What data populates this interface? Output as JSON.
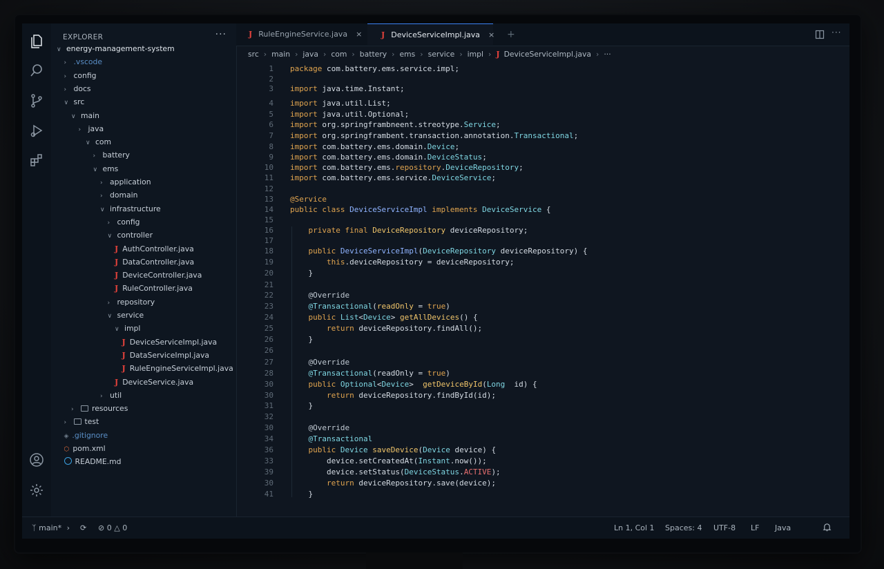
{
  "sidebar": {
    "title": "EXPLORER",
    "more": "···",
    "tree": [
      {
        "label": "energy-management-system",
        "depth": 0,
        "kind": "folder-open"
      },
      {
        "label": ".vscode",
        "depth": 1,
        "kind": "folder-closed",
        "dim": true
      },
      {
        "label": "config",
        "depth": 1,
        "kind": "folder-closed"
      },
      {
        "label": "docs",
        "depth": 1,
        "kind": "folder-closed"
      },
      {
        "label": "src",
        "depth": 1,
        "kind": "folder-open"
      },
      {
        "label": "main",
        "depth": 2,
        "kind": "folder-open"
      },
      {
        "label": "java",
        "depth": 3,
        "kind": "folder-closed"
      },
      {
        "label": "com",
        "depth": 4,
        "kind": "folder-open"
      },
      {
        "label": "battery",
        "depth": 5,
        "kind": "folder-closed"
      },
      {
        "label": "ems",
        "depth": 5,
        "kind": "folder-open"
      },
      {
        "label": "application",
        "depth": 6,
        "kind": "folder-closed"
      },
      {
        "label": "domain",
        "depth": 6,
        "kind": "folder-closed"
      },
      {
        "label": "infrastructure",
        "depth": 6,
        "kind": "folder-open"
      },
      {
        "label": "config",
        "depth": 7,
        "kind": "folder-closed"
      },
      {
        "label": "controller",
        "depth": 7,
        "kind": "folder-open"
      },
      {
        "label": "AuthController.java",
        "depth": 8,
        "kind": "java"
      },
      {
        "label": "DataController.java",
        "depth": 8,
        "kind": "java"
      },
      {
        "label": "DeviceController.java",
        "depth": 8,
        "kind": "java"
      },
      {
        "label": "RuleController.java",
        "depth": 8,
        "kind": "java"
      },
      {
        "label": "repository",
        "depth": 7,
        "kind": "folder-closed"
      },
      {
        "label": "service",
        "depth": 7,
        "kind": "folder-open"
      },
      {
        "label": "impl",
        "depth": 8,
        "kind": "folder-open"
      },
      {
        "label": "DeviceServiceImpl.java",
        "depth": 9,
        "kind": "java"
      },
      {
        "label": "DataServiceImpl.java",
        "depth": 9,
        "kind": "java"
      },
      {
        "label": "RuleEngineServiceImpl.java",
        "depth": 9,
        "kind": "java"
      },
      {
        "label": "DeviceService.java",
        "depth": 8,
        "kind": "java"
      },
      {
        "label": "util",
        "depth": 6,
        "kind": "folder-closed"
      },
      {
        "label": "resources",
        "depth": 2,
        "kind": "folder-closed-icon"
      },
      {
        "label": "test",
        "depth": 1,
        "kind": "folder-closed-icon"
      },
      {
        "label": ".gitignore",
        "depth": 1,
        "kind": "git"
      },
      {
        "label": "pom.xml",
        "depth": 1,
        "kind": "xml"
      },
      {
        "label": "README.md",
        "depth": 1,
        "kind": "md"
      }
    ]
  },
  "tabs": [
    {
      "label": "RuleEngineService.java",
      "close": "×",
      "active": false
    },
    {
      "label": "DeviceServiceImpl.java",
      "close": "×",
      "active": true
    }
  ],
  "tab_add": "+",
  "breadcrumb": [
    "src",
    "main",
    "java",
    "com",
    "battery",
    "ems",
    "service",
    "impl",
    "DeviceServiceImpl.java",
    "···"
  ],
  "code": [
    {
      "n": "1",
      "t": [
        [
          "kw",
          "package"
        ],
        [
          "pl",
          " com.battery.ems.service.impl;"
        ]
      ]
    },
    {
      "n": "2",
      "t": []
    },
    {
      "n": "3",
      "t": [
        [
          "kw",
          "import"
        ],
        [
          "pl",
          " java.time.Instant;"
        ]
      ]
    },
    {
      "n": "4",
      "t": [
        [
          "kw",
          "import"
        ],
        [
          "pl",
          " java.util.List;"
        ]
      ]
    },
    {
      "n": "5",
      "t": [
        [
          "kw",
          "import"
        ],
        [
          "pl",
          " java.util.Optional;"
        ]
      ]
    },
    {
      "n": "6",
      "t": [
        [
          "kw",
          "import"
        ],
        [
          "pl",
          " org.springframbneent.streotype."
        ],
        [
          "ty",
          "Service"
        ],
        [
          "pl",
          ";"
        ]
      ]
    },
    {
      "n": "7",
      "t": [
        [
          "kw",
          "import"
        ],
        [
          "pl",
          " org.springframbent.transaction.annotation."
        ],
        [
          "ty",
          "Transactional"
        ],
        [
          "pl",
          ";"
        ]
      ]
    },
    {
      "n": "8",
      "t": [
        [
          "kw",
          "import"
        ],
        [
          "pl",
          " com.battery.ems.domain."
        ],
        [
          "ty",
          "Device"
        ],
        [
          "pl",
          ";"
        ]
      ]
    },
    {
      "n": "9",
      "t": [
        [
          "kw",
          "import"
        ],
        [
          "pl",
          " com.battery.ems.domain."
        ],
        [
          "ty",
          "DeviceStatus"
        ],
        [
          "pl",
          ";"
        ]
      ]
    },
    {
      "n": "10",
      "t": [
        [
          "kw",
          "import"
        ],
        [
          "pl",
          " com.battery.ems."
        ],
        [
          "kw",
          "repository"
        ],
        [
          "pl",
          "."
        ],
        [
          "ty",
          "DeviceRepository"
        ],
        [
          "pl",
          ";"
        ]
      ]
    },
    {
      "n": "11",
      "t": [
        [
          "kw",
          "import"
        ],
        [
          "pl",
          " com.battery.ems.service."
        ],
        [
          "ty",
          "DeviceService"
        ],
        [
          "pl",
          ";"
        ]
      ]
    },
    {
      "n": "12",
      "t": []
    },
    {
      "n": "13",
      "t": [
        [
          "kw",
          "@Service"
        ]
      ]
    },
    {
      "n": "14",
      "t": [
        [
          "kw",
          "public class "
        ],
        [
          "cls",
          "DeviceServiceImpl"
        ],
        [
          "kw",
          " implements "
        ],
        [
          "ty",
          "DeviceService"
        ],
        [
          "pl",
          " {"
        ]
      ]
    },
    {
      "n": "15",
      "t": []
    },
    {
      "n": "16",
      "t": [
        [
          "pl",
          "    "
        ],
        [
          "kw",
          "private final "
        ],
        [
          "fn",
          "DeviceRepository"
        ],
        [
          "pl",
          " deviceRepository;"
        ]
      ]
    },
    {
      "n": "17",
      "t": []
    },
    {
      "n": "18",
      "t": [
        [
          "pl",
          "    "
        ],
        [
          "kw",
          "public "
        ],
        [
          "cls",
          "DeviceServiceImpl"
        ],
        [
          "pl",
          "("
        ],
        [
          "ty",
          "DeviceRepository"
        ],
        [
          "pl",
          " deviceRepository) {"
        ]
      ]
    },
    {
      "n": "19",
      "t": [
        [
          "pl",
          "        "
        ],
        [
          "kw",
          "this"
        ],
        [
          "pl",
          ".deviceRepository = deviceRepository;"
        ]
      ]
    },
    {
      "n": "20",
      "t": [
        [
          "pl",
          "    }"
        ]
      ]
    },
    {
      "n": "21",
      "t": []
    },
    {
      "n": "22",
      "t": [
        [
          "pl",
          "    "
        ],
        [
          "an",
          "@Override"
        ]
      ]
    },
    {
      "n": "23",
      "t": [
        [
          "pl",
          "    "
        ],
        [
          "ty",
          "@Transactional"
        ],
        [
          "pl",
          "("
        ],
        [
          "fn",
          "readOnly"
        ],
        [
          "pl",
          " = "
        ],
        [
          "kw",
          "true"
        ],
        [
          "pl",
          ")"
        ]
      ]
    },
    {
      "n": "24",
      "t": [
        [
          "pl",
          "    "
        ],
        [
          "kw",
          "public "
        ],
        [
          "ty",
          "List"
        ],
        [
          "pl",
          "<"
        ],
        [
          "ty",
          "Device"
        ],
        [
          "pl",
          "> "
        ],
        [
          "fn",
          "getAllDevices"
        ],
        [
          "pl",
          "() {"
        ]
      ]
    },
    {
      "n": "25",
      "t": [
        [
          "pl",
          "        "
        ],
        [
          "kw",
          "return"
        ],
        [
          "pl",
          " deviceRepository.findAll();"
        ]
      ]
    },
    {
      "n": "26",
      "t": [
        [
          "pl",
          "    }"
        ]
      ]
    },
    {
      "n": "26",
      "t": []
    },
    {
      "n": "27",
      "t": [
        [
          "pl",
          "    "
        ],
        [
          "an",
          "@Override"
        ]
      ]
    },
    {
      "n": "28",
      "t": [
        [
          "pl",
          "    "
        ],
        [
          "ty",
          "@Transactional"
        ],
        [
          "pl",
          "(readOnly = "
        ],
        [
          "kw",
          "true"
        ],
        [
          "pl",
          ")"
        ]
      ]
    },
    {
      "n": "30",
      "t": [
        [
          "pl",
          "    "
        ],
        [
          "kw",
          "public "
        ],
        [
          "ty",
          "Optional"
        ],
        [
          "pl",
          "<"
        ],
        [
          "ty",
          "Device"
        ],
        [
          "pl",
          ">  "
        ],
        [
          "fn",
          "getDeviceById"
        ],
        [
          "pl",
          "("
        ],
        [
          "ty",
          "Long"
        ],
        [
          "pl",
          "  id) {"
        ]
      ]
    },
    {
      "n": "30",
      "t": [
        [
          "pl",
          "        "
        ],
        [
          "kw",
          "return"
        ],
        [
          "pl",
          " deviceRepository.findById(id);"
        ]
      ]
    },
    {
      "n": "31",
      "t": [
        [
          "pl",
          "    }"
        ]
      ]
    },
    {
      "n": "32",
      "t": []
    },
    {
      "n": "30",
      "t": [
        [
          "pl",
          "    "
        ],
        [
          "an",
          "@Override"
        ]
      ]
    },
    {
      "n": "34",
      "t": [
        [
          "pl",
          "    "
        ],
        [
          "ty",
          "@Transactional"
        ]
      ]
    },
    {
      "n": "36",
      "t": [
        [
          "pl",
          "    "
        ],
        [
          "kw",
          "public "
        ],
        [
          "ty",
          "Device"
        ],
        [
          "pl",
          " "
        ],
        [
          "fn",
          "saveDevice"
        ],
        [
          "pl",
          "("
        ],
        [
          "ty",
          "Device"
        ],
        [
          "pl",
          " device) {"
        ]
      ]
    },
    {
      "n": "33",
      "t": [
        [
          "pl",
          "        device.setCreatedAt("
        ],
        [
          "ty",
          "Instant"
        ],
        [
          "pl",
          ".now());"
        ]
      ]
    },
    {
      "n": "39",
      "t": [
        [
          "pl",
          "        device.setStatus("
        ],
        [
          "ty",
          "DeviceStatus"
        ],
        [
          "pl",
          "."
        ],
        [
          "st",
          "ACTIVE"
        ],
        [
          "pl",
          ");"
        ]
      ]
    },
    {
      "n": "30",
      "t": [
        [
          "pl",
          "        "
        ],
        [
          "kw",
          "return"
        ],
        [
          "pl",
          " deviceRepository.save(device);"
        ]
      ]
    },
    {
      "n": "41",
      "t": [
        [
          "pl",
          "    }"
        ]
      ]
    }
  ],
  "status": {
    "branch": "main*",
    "errors": "0",
    "warnings": "0",
    "position": "Ln 1, Col 1",
    "spaces": "Spaces: 4",
    "encoding": "UTF-8",
    "eol": "LF",
    "language": "Java"
  }
}
